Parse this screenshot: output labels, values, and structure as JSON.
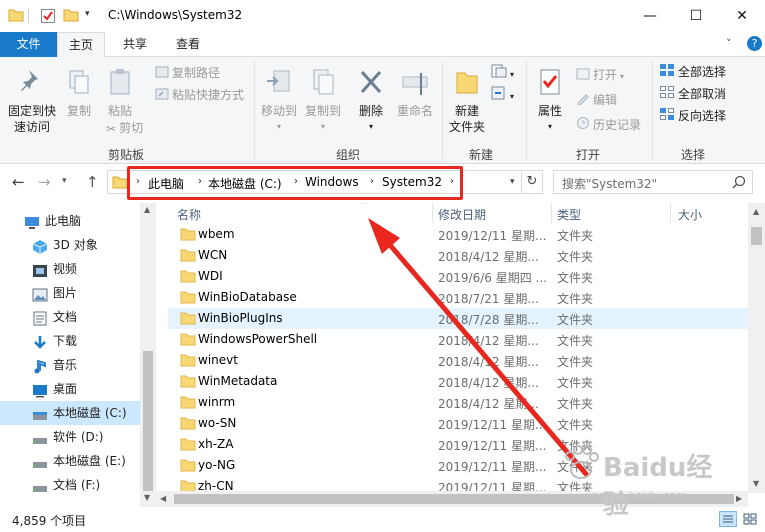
{
  "window": {
    "title": "C:\\Windows\\System32",
    "minimize": "—",
    "maximize": "☐",
    "close": "✕"
  },
  "ribbon_tabs": [
    {
      "label": "文件"
    },
    {
      "label": "主页"
    },
    {
      "label": "共享"
    },
    {
      "label": "查看"
    }
  ],
  "ribbon": {
    "clipboard": {
      "pin_label_1": "固定到快",
      "pin_label_2": "速访问",
      "copy": "复制",
      "paste": "粘贴",
      "copy_path": "复制路径",
      "paste_shortcut": "粘贴快捷方式",
      "cut": "剪切",
      "group": "剪贴板"
    },
    "organize": {
      "move_to": "移动到",
      "copy_to": "复制到",
      "delete": "删除",
      "rename": "重命名",
      "group": "组织"
    },
    "new": {
      "new_folder_1": "新建",
      "new_folder_2": "文件夹",
      "group": "新建"
    },
    "open": {
      "properties": "属性",
      "open": "打开",
      "edit": "编辑",
      "history": "历史记录",
      "group": "打开"
    },
    "select": {
      "select_all": "全部选择",
      "select_none": "全部取消",
      "invert": "反向选择",
      "group": "选择"
    }
  },
  "address": {
    "crumbs": [
      "此电脑",
      "本地磁盘 (C:)",
      "Windows",
      "System32"
    ],
    "search_placeholder": "搜索\"System32\""
  },
  "nav_pane": [
    {
      "label": "此电脑",
      "icon": "pc-icon"
    },
    {
      "label": "3D 对象",
      "icon": "3d-objects-icon"
    },
    {
      "label": "视频",
      "icon": "video-icon"
    },
    {
      "label": "图片",
      "icon": "pictures-icon"
    },
    {
      "label": "文档",
      "icon": "documents-icon"
    },
    {
      "label": "下载",
      "icon": "download-icon"
    },
    {
      "label": "音乐",
      "icon": "music-icon"
    },
    {
      "label": "桌面",
      "icon": "desktop-icon"
    },
    {
      "label": "本地磁盘 (C:)",
      "icon": "drive-icon"
    },
    {
      "label": "软件 (D:)",
      "icon": "drive-icon"
    },
    {
      "label": "本地磁盘 (E:)",
      "icon": "drive-icon"
    },
    {
      "label": "文档 (F:)",
      "icon": "drive-icon"
    }
  ],
  "columns": {
    "name": "名称",
    "date": "修改日期",
    "type": "类型",
    "size": "大小"
  },
  "files": [
    {
      "name": "wbem",
      "date": "2019/12/11 星期...",
      "type": "文件夹"
    },
    {
      "name": "WCN",
      "date": "2018/4/12 星期...",
      "type": "文件夹"
    },
    {
      "name": "WDI",
      "date": "2019/6/6 星期四 ...",
      "type": "文件夹"
    },
    {
      "name": "WinBioDatabase",
      "date": "2018/7/21 星期...",
      "type": "文件夹"
    },
    {
      "name": "WinBioPlugIns",
      "date": "2018/7/28 星期...",
      "type": "文件夹"
    },
    {
      "name": "WindowsPowerShell",
      "date": "2018/4/12 星期...",
      "type": "文件夹"
    },
    {
      "name": "winevt",
      "date": "2018/4/12 星期...",
      "type": "文件夹"
    },
    {
      "name": "WinMetadata",
      "date": "2018/4/12 星期...",
      "type": "文件夹"
    },
    {
      "name": "winrm",
      "date": "2018/4/12 星期...",
      "type": "文件夹"
    },
    {
      "name": "wo-SN",
      "date": "2019/12/11 星期...",
      "type": "文件夹"
    },
    {
      "name": "xh-ZA",
      "date": "2019/12/11 星期...",
      "type": "文件夹"
    },
    {
      "name": "yo-NG",
      "date": "2019/12/11 星期...",
      "type": "文件夹"
    },
    {
      "name": "zh-CN",
      "date": "2019/12/11 星期...",
      "type": "文件夹"
    }
  ],
  "status": {
    "count": "4,859 个项目"
  },
  "watermark": {
    "brand": "Baidu经验",
    "url": "jingyan.baidu.com"
  },
  "colors": {
    "accent": "#1979ca",
    "annotation_red": "#e8271f",
    "folder": "#f8d775",
    "selection": "#cce8ff"
  }
}
